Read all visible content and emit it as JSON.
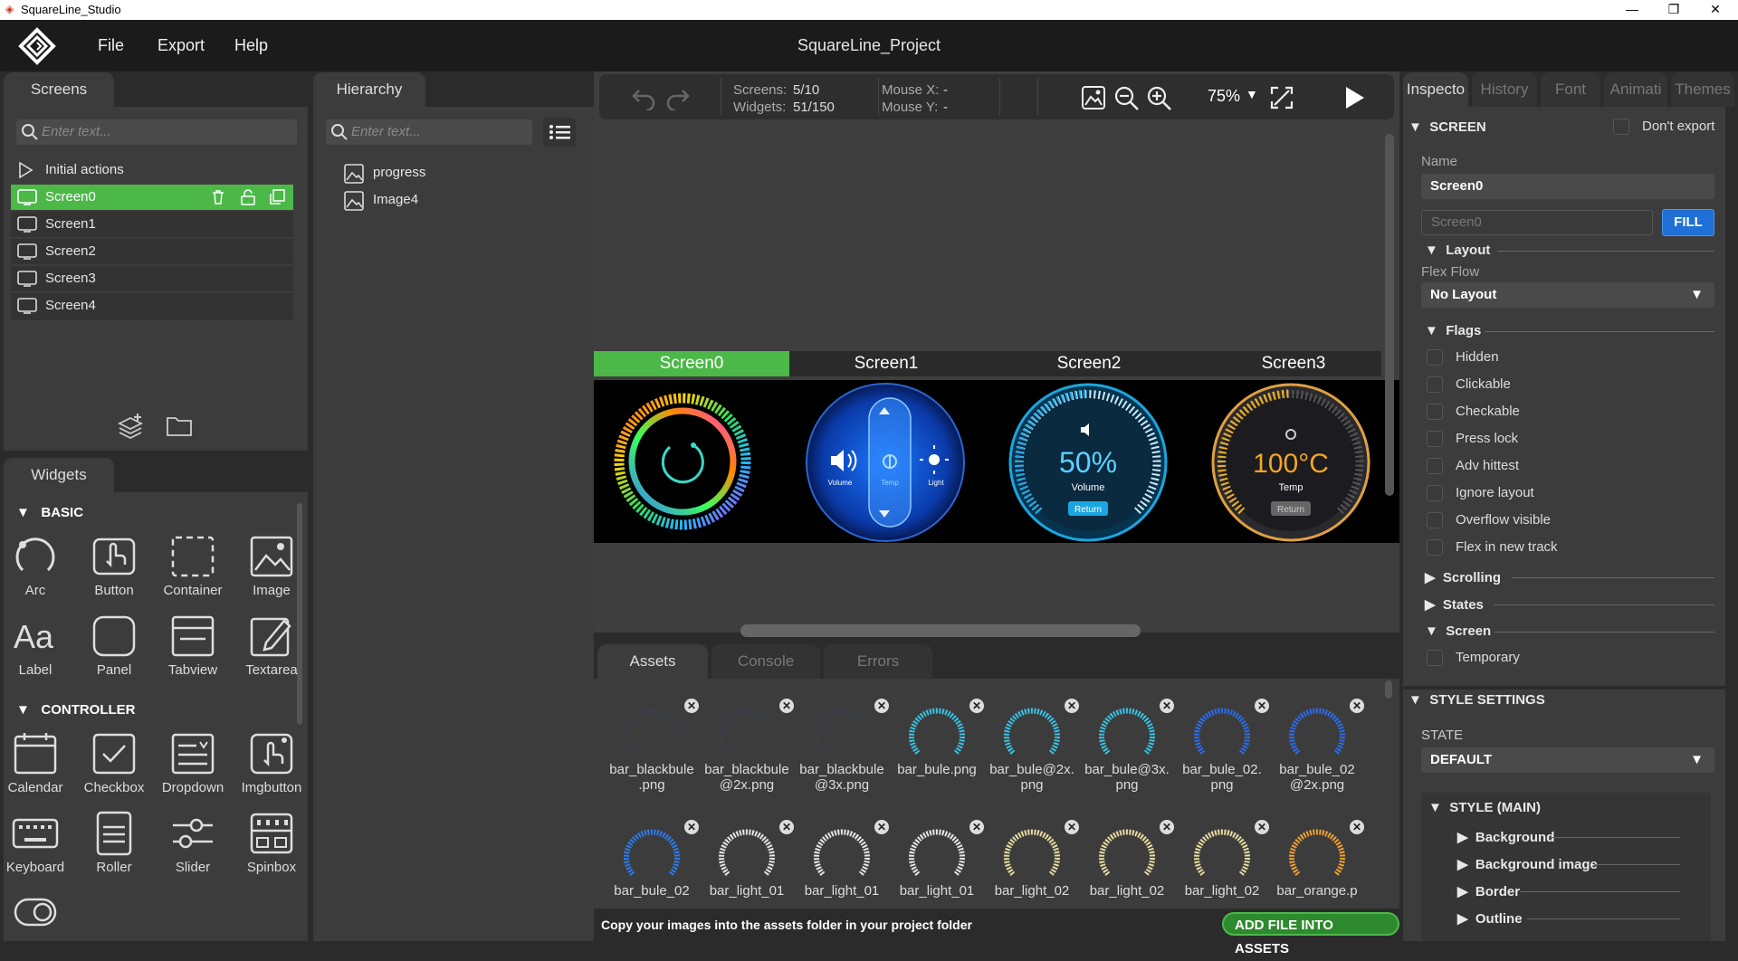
{
  "titlebar": {
    "title": "SquareLine_Studio",
    "minimize": "—",
    "maximize": "❐",
    "close": "✕"
  },
  "menu": {
    "file": "File",
    "export": "Export",
    "help": "Help"
  },
  "project_title": "SquareLine_Project",
  "screens_panel": {
    "tab": "Screens",
    "search_placeholder": "Enter text...",
    "initial_actions": "Initial actions",
    "items": [
      "Screen0",
      "Screen1",
      "Screen2",
      "Screen3",
      "Screen4"
    ]
  },
  "hierarchy_panel": {
    "tab": "Hierarchy",
    "search_placeholder": "Enter text...",
    "items": [
      "progress",
      "Image4"
    ]
  },
  "widgets_panel": {
    "tab": "Widgets",
    "sections": {
      "basic": "BASIC",
      "controller": "CONTROLLER"
    },
    "basic": [
      "Arc",
      "Button",
      "Container",
      "Image",
      "Label",
      "Panel",
      "Tabview",
      "Textarea"
    ],
    "controller": [
      "Calendar",
      "Checkbox",
      "Dropdown",
      "Imgbutton",
      "Keyboard",
      "Roller",
      "Slider",
      "Spinbox"
    ]
  },
  "toolbar": {
    "screens_label": "Screens:",
    "screens_value": "5/10",
    "widgets_label": "Widgets:",
    "widgets_value": "51/150",
    "mouse_x_label": "Mouse X:",
    "mouse_x_value": "-",
    "mouse_y_label": "Mouse Y:",
    "mouse_y_value": "-",
    "zoom": "75%"
  },
  "canvas": {
    "screen_tabs": [
      "Screen0",
      "Screen1",
      "Screen2",
      "Screen3"
    ],
    "screen1": {
      "volume": "Volume",
      "temp": "Temp",
      "light": "Light"
    },
    "screen2": {
      "value": "50%",
      "label": "Volume",
      "btn": "Return"
    },
    "screen3": {
      "value": "100°C",
      "label": "Temp",
      "btn": "Return"
    }
  },
  "bottom_tabs": {
    "assets": "Assets",
    "console": "Console",
    "errors": "Errors"
  },
  "assets": {
    "row1": [
      "bar_blackbule\n.png",
      "bar_blackbule\n@2x.png",
      "bar_blackbule\n@3x.png",
      "bar_bule.png",
      "bar_bule@2x.\npng",
      "bar_bule@3x.\npng",
      "bar_bule_02.\npng",
      "bar_bule_02\n@2x.png"
    ],
    "row2": [
      "bar_bule_02",
      "bar_light_01",
      "bar_light_01",
      "bar_light_01",
      "bar_light_02",
      "bar_light_02",
      "bar_light_02",
      "bar_orange.p"
    ],
    "footer": "Copy your images into the assets folder in your project folder",
    "add_button": "ADD FILE INTO ASSETS"
  },
  "inspector": {
    "tabs": [
      "Inspecto",
      "History",
      "Font",
      "Animati",
      "Themes"
    ],
    "screen_header": "SCREEN",
    "dont_export": "Don't export",
    "name_label": "Name",
    "name_value": "Screen0",
    "fill_value": "Screen0",
    "fill_button": "FILL",
    "layout": "Layout",
    "flex_flow": "Flex Flow",
    "layout_value": "No Layout",
    "flags": "Flags",
    "flag_items": [
      "Hidden",
      "Clickable",
      "Checkable",
      "Press lock",
      "Adv hittest",
      "Ignore layout",
      "Overflow visible",
      "Flex in new track"
    ],
    "scrolling": "Scrolling",
    "states": "States",
    "screen": "Screen",
    "temporary": "Temporary",
    "style_settings": "STYLE SETTINGS",
    "state_label": "STATE",
    "state_value": "DEFAULT",
    "style_main": "STYLE (MAIN)",
    "style_items": [
      "Background",
      "Background image",
      "Border",
      "Outline"
    ]
  },
  "colors": {
    "accent_green": "#4cb848",
    "fill_blue": "#1e6fd6"
  }
}
